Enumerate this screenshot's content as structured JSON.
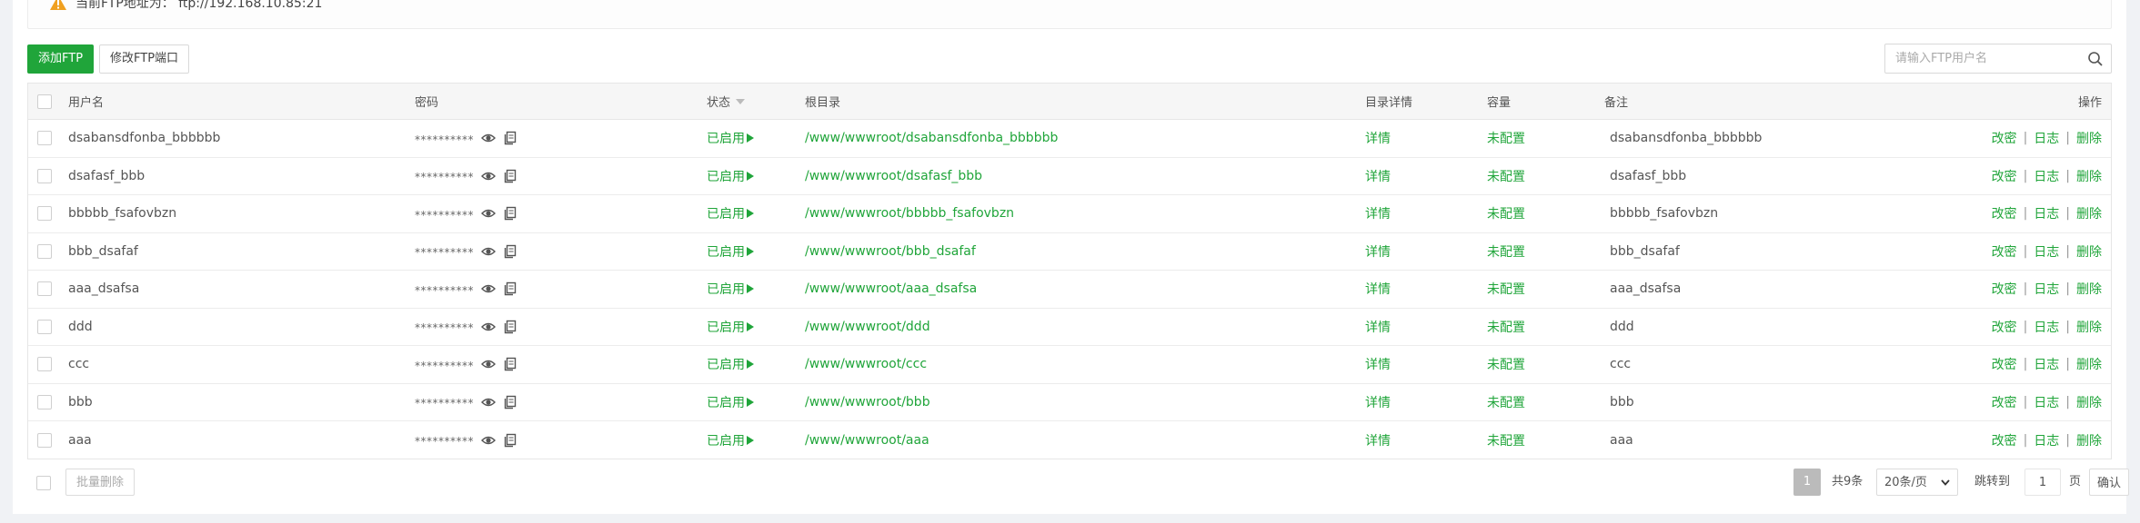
{
  "notice": {
    "text": "当前FTP地址为： ftp://192.168.10.85:21"
  },
  "toolbar": {
    "add_label": "添加FTP",
    "port_label": "修改FTP端口"
  },
  "search": {
    "placeholder": "请输入FTP用户名"
  },
  "table": {
    "headers": {
      "username": "用户名",
      "password": "密码",
      "status": "状态",
      "root": "根目录",
      "detail": "目录详情",
      "capacity": "容量",
      "remark": "备注",
      "actions": "操作"
    },
    "rows": [
      {
        "username": "dsabansdfonba_bbbbbb",
        "password": "**********",
        "status": "已启用",
        "root": "/www/wwwroot/dsabansdfonba_bbbbbb",
        "detail": "详情",
        "capacity": "未配置",
        "remark": "dsabansdfonba_bbbbbb",
        "act_pass": "改密",
        "act_log": "日志",
        "act_del": "删除"
      },
      {
        "username": "dsafasf_bbb",
        "password": "**********",
        "status": "已启用",
        "root": "/www/wwwroot/dsafasf_bbb",
        "detail": "详情",
        "capacity": "未配置",
        "remark": "dsafasf_bbb",
        "act_pass": "改密",
        "act_log": "日志",
        "act_del": "删除"
      },
      {
        "username": "bbbbb_fsafovbzn",
        "password": "**********",
        "status": "已启用",
        "root": "/www/wwwroot/bbbbb_fsafovbzn",
        "detail": "详情",
        "capacity": "未配置",
        "remark": "bbbbb_fsafovbzn",
        "act_pass": "改密",
        "act_log": "日志",
        "act_del": "删除"
      },
      {
        "username": "bbb_dsafaf",
        "password": "**********",
        "status": "已启用",
        "root": "/www/wwwroot/bbb_dsafaf",
        "detail": "详情",
        "capacity": "未配置",
        "remark": "bbb_dsafaf",
        "act_pass": "改密",
        "act_log": "日志",
        "act_del": "删除"
      },
      {
        "username": "aaa_dsafsa",
        "password": "**********",
        "status": "已启用",
        "root": "/www/wwwroot/aaa_dsafsa",
        "detail": "详情",
        "capacity": "未配置",
        "remark": "aaa_dsafsa",
        "act_pass": "改密",
        "act_log": "日志",
        "act_del": "删除"
      },
      {
        "username": "ddd",
        "password": "**********",
        "status": "已启用",
        "root": "/www/wwwroot/ddd",
        "detail": "详情",
        "capacity": "未配置",
        "remark": "ddd",
        "act_pass": "改密",
        "act_log": "日志",
        "act_del": "删除"
      },
      {
        "username": "ccc",
        "password": "**********",
        "status": "已启用",
        "root": "/www/wwwroot/ccc",
        "detail": "详情",
        "capacity": "未配置",
        "remark": "ccc",
        "act_pass": "改密",
        "act_log": "日志",
        "act_del": "删除"
      },
      {
        "username": "bbb",
        "password": "**********",
        "status": "已启用",
        "root": "/www/wwwroot/bbb",
        "detail": "详情",
        "capacity": "未配置",
        "remark": "bbb",
        "act_pass": "改密",
        "act_log": "日志",
        "act_del": "删除"
      },
      {
        "username": "aaa",
        "password": "**********",
        "status": "已启用",
        "root": "/www/wwwroot/aaa",
        "detail": "详情",
        "capacity": "未配置",
        "remark": "aaa",
        "act_pass": "改密",
        "act_log": "日志",
        "act_del": "删除"
      }
    ]
  },
  "footer": {
    "batch_delete": "批量删除",
    "current_page": "1",
    "total": "共9条",
    "per_page": "20条/页",
    "goto_label": "跳转到",
    "goto_value": "1",
    "page_unit": "页",
    "confirm": "确认"
  },
  "colors": {
    "accent": "#20a53a",
    "warning": "#f0a020"
  }
}
